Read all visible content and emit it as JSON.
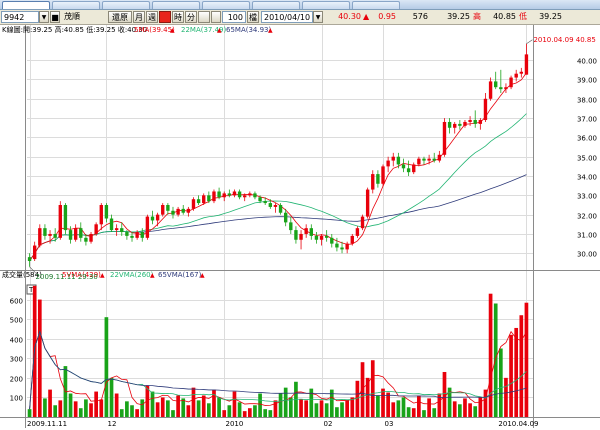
{
  "tabs": [
    "",
    ""
  ],
  "toolbar": {
    "stock_code": "9942",
    "stock_name": "茂順",
    "buttons": [
      "還原",
      "月",
      "週",
      "",
      "時",
      "分",
      "",
      "",
      "100",
      "檔"
    ],
    "date": "2010/04/10",
    "quote": [
      {
        "text": "40.30",
        "color": "#e8000b"
      },
      {
        "text": "▲",
        "color": "#e8000b"
      },
      {
        "text": "0.95",
        "color": "#e8000b"
      },
      {
        "text": "576",
        "color": "#000000"
      },
      {
        "text": "39.25",
        "color": "#000000"
      },
      {
        "text": "高",
        "color": "#e8000b"
      },
      {
        "text": "40.85",
        "color": "#000000"
      },
      {
        "text": "低",
        "color": "#e8000b"
      },
      {
        "text": "39.25",
        "color": "#000000"
      }
    ]
  },
  "chart_data": [
    {
      "type": "candlestick",
      "header": "K線圖:開:39.25 高:40.85 低:39.25 收:40.30",
      "mas": [
        {
          "label": "5MA(39.45)",
          "color": "#e8000b"
        },
        {
          "label": "22MA(37.49)",
          "color": "#22b573"
        },
        {
          "label": "65MA(34.93)",
          "color": "#2e3a7a"
        }
      ],
      "ylim": [
        29.6,
        41.2
      ],
      "y_ticks": [
        "30.00",
        "31.00",
        "32.00",
        "33.00",
        "34.00",
        "35.00",
        "36.00",
        "37.00",
        "38.00",
        "39.00",
        "40.00"
      ],
      "x_ticks": [
        {
          "label": "2009.11.11",
          "index": 0
        },
        {
          "label": "12",
          "index": 15
        },
        {
          "label": "2010",
          "index": 38
        },
        {
          "label": "02",
          "index": 57
        },
        {
          "label": "03",
          "index": 69
        },
        {
          "label": "2010.04.09",
          "index": 97
        }
      ],
      "annotations": {
        "low": "2009.11.11  29.30",
        "high": "2010.04.09   40.85"
      },
      "candles": [
        [
          29.8,
          30.0,
          29.3,
          29.6
        ],
        [
          29.7,
          30.6,
          29.6,
          30.4
        ],
        [
          30.4,
          31.5,
          30.3,
          31.3
        ],
        [
          31.3,
          31.5,
          30.7,
          30.9
        ],
        [
          30.9,
          31.2,
          30.5,
          31.0
        ],
        [
          31.0,
          31.3,
          30.6,
          30.8
        ],
        [
          30.8,
          32.7,
          30.7,
          32.5
        ],
        [
          32.5,
          32.6,
          31.0,
          31.2
        ],
        [
          31.2,
          31.4,
          30.5,
          30.7
        ],
        [
          30.7,
          31.5,
          30.6,
          31.3
        ],
        [
          31.3,
          31.6,
          30.6,
          30.8
        ],
        [
          30.8,
          31.0,
          30.4,
          30.6
        ],
        [
          30.6,
          31.1,
          30.5,
          31.0
        ],
        [
          31.0,
          31.6,
          30.9,
          31.5
        ],
        [
          31.5,
          32.6,
          31.2,
          32.5
        ],
        [
          32.5,
          32.6,
          31.6,
          31.8
        ],
        [
          31.8,
          32.0,
          31.1,
          31.2
        ],
        [
          31.2,
          31.5,
          30.9,
          31.3
        ],
        [
          31.3,
          31.6,
          30.9,
          31.1
        ],
        [
          31.1,
          31.2,
          30.7,
          30.9
        ],
        [
          30.9,
          31.1,
          30.6,
          30.8
        ],
        [
          30.8,
          31.2,
          30.7,
          31.1
        ],
        [
          31.1,
          31.3,
          30.6,
          30.8
        ],
        [
          30.8,
          32.0,
          30.7,
          31.9
        ],
        [
          31.9,
          32.2,
          31.5,
          31.7
        ],
        [
          31.7,
          32.1,
          31.4,
          32.0
        ],
        [
          32.0,
          32.6,
          31.9,
          32.5
        ],
        [
          32.5,
          32.6,
          32.0,
          32.2
        ],
        [
          32.2,
          32.4,
          31.8,
          32.0
        ],
        [
          32.0,
          32.4,
          31.9,
          32.3
        ],
        [
          32.3,
          32.5,
          32.0,
          32.1
        ],
        [
          32.1,
          32.4,
          31.9,
          32.3
        ],
        [
          32.3,
          32.9,
          32.2,
          32.8
        ],
        [
          32.8,
          33.0,
          32.5,
          32.6
        ],
        [
          32.6,
          33.1,
          32.5,
          33.0
        ],
        [
          33.0,
          33.2,
          32.6,
          32.7
        ],
        [
          32.7,
          33.3,
          32.6,
          33.2
        ],
        [
          33.2,
          33.4,
          32.8,
          32.9
        ],
        [
          32.9,
          33.2,
          32.7,
          33.1
        ],
        [
          33.1,
          33.3,
          32.9,
          33.0
        ],
        [
          33.0,
          33.3,
          32.9,
          33.2
        ],
        [
          33.2,
          33.3,
          32.8,
          32.9
        ],
        [
          32.9,
          33.1,
          32.7,
          33.0
        ],
        [
          33.0,
          33.2,
          32.9,
          33.1
        ],
        [
          33.1,
          33.2,
          32.8,
          32.9
        ],
        [
          32.9,
          33.0,
          32.6,
          32.7
        ],
        [
          32.7,
          32.9,
          32.5,
          32.6
        ],
        [
          32.6,
          32.8,
          32.3,
          32.4
        ],
        [
          32.4,
          32.6,
          32.1,
          32.5
        ],
        [
          32.5,
          32.6,
          32.0,
          32.1
        ],
        [
          32.1,
          32.3,
          31.4,
          31.6
        ],
        [
          31.6,
          31.9,
          31.0,
          31.2
        ],
        [
          31.2,
          31.4,
          30.5,
          30.7
        ],
        [
          30.7,
          31.2,
          30.2,
          31.0
        ],
        [
          31.0,
          31.5,
          30.8,
          31.3
        ],
        [
          31.3,
          31.5,
          30.7,
          30.9
        ],
        [
          30.9,
          31.1,
          30.5,
          30.7
        ],
        [
          30.7,
          31.0,
          30.4,
          30.9
        ],
        [
          30.9,
          31.2,
          30.6,
          30.8
        ],
        [
          30.8,
          31.0,
          30.3,
          30.5
        ],
        [
          30.5,
          30.8,
          30.1,
          30.3
        ],
        [
          30.3,
          30.6,
          30.0,
          30.2
        ],
        [
          30.2,
          30.6,
          30.0,
          30.5
        ],
        [
          30.5,
          31.0,
          30.4,
          30.9
        ],
        [
          30.9,
          31.4,
          30.8,
          31.3
        ],
        [
          31.3,
          32.0,
          31.2,
          31.9
        ],
        [
          31.9,
          33.4,
          31.8,
          33.3
        ],
        [
          33.3,
          34.3,
          33.1,
          34.1
        ],
        [
          34.1,
          34.3,
          33.4,
          33.6
        ],
        [
          33.6,
          34.6,
          33.5,
          34.5
        ],
        [
          34.5,
          35.0,
          34.2,
          34.8
        ],
        [
          34.8,
          35.2,
          34.5,
          35.0
        ],
        [
          35.0,
          35.2,
          34.4,
          34.6
        ],
        [
          34.6,
          34.9,
          34.2,
          34.4
        ],
        [
          34.4,
          34.8,
          34.0,
          34.2
        ],
        [
          34.2,
          34.7,
          34.1,
          34.6
        ],
        [
          34.6,
          35.0,
          34.5,
          34.9
        ],
        [
          34.9,
          35.0,
          34.6,
          34.8
        ],
        [
          34.8,
          35.1,
          34.6,
          34.9
        ],
        [
          34.9,
          35.2,
          34.7,
          34.8
        ],
        [
          34.8,
          35.3,
          34.7,
          35.1
        ],
        [
          35.1,
          37.0,
          35.0,
          36.8
        ],
        [
          36.8,
          37.0,
          36.2,
          36.5
        ],
        [
          36.5,
          36.8,
          36.2,
          36.7
        ],
        [
          36.7,
          36.9,
          36.4,
          36.6
        ],
        [
          36.6,
          36.9,
          36.5,
          36.8
        ],
        [
          36.8,
          37.1,
          36.6,
          36.9
        ],
        [
          36.9,
          37.4,
          36.5,
          36.7
        ],
        [
          36.7,
          37.0,
          36.4,
          36.9
        ],
        [
          36.9,
          38.3,
          36.8,
          38.0
        ],
        [
          38.0,
          39.1,
          37.9,
          38.9
        ],
        [
          38.9,
          39.4,
          38.5,
          38.6
        ],
        [
          38.6,
          39.5,
          38.3,
          38.5
        ],
        [
          38.5,
          38.8,
          38.3,
          38.6
        ],
        [
          38.6,
          39.2,
          38.5,
          39.1
        ],
        [
          39.1,
          39.5,
          38.9,
          39.3
        ],
        [
          39.3,
          39.6,
          39.1,
          39.4
        ],
        [
          39.25,
          40.85,
          39.25,
          40.3
        ]
      ]
    },
    {
      "type": "bar",
      "header": "成交量(584)",
      "mas": [
        {
          "label": "5VMA(429)",
          "color": "#e8000b"
        },
        {
          "label": "22VMA(260)",
          "color": "#22b573"
        },
        {
          "label": "65VMA(167)",
          "color": "#2e3a7a"
        }
      ],
      "ylim": [
        0,
        700
      ],
      "y_ticks": [
        "100",
        "200",
        "300",
        "400",
        "500",
        "600"
      ],
      "t_label": "T",
      "volumes": [
        40,
        670,
        600,
        95,
        140,
        60,
        85,
        260,
        120,
        80,
        45,
        90,
        70,
        130,
        90,
        510,
        200,
        120,
        40,
        80,
        60,
        40,
        90,
        160,
        130,
        75,
        100,
        85,
        35,
        110,
        95,
        60,
        150,
        85,
        110,
        70,
        140,
        100,
        35,
        60,
        130,
        75,
        30,
        45,
        60,
        120,
        40,
        35,
        85,
        120,
        150,
        100,
        180,
        90,
        85,
        145,
        70,
        85,
        70,
        140,
        50,
        75,
        85,
        100,
        185,
        280,
        200,
        290,
        110,
        145,
        125,
        75,
        85,
        100,
        50,
        45,
        110,
        35,
        95,
        45,
        120,
        230,
        150,
        80,
        65,
        95,
        70,
        55,
        100,
        140,
        630,
        580,
        350,
        200,
        420,
        455,
        520,
        584
      ]
    }
  ]
}
